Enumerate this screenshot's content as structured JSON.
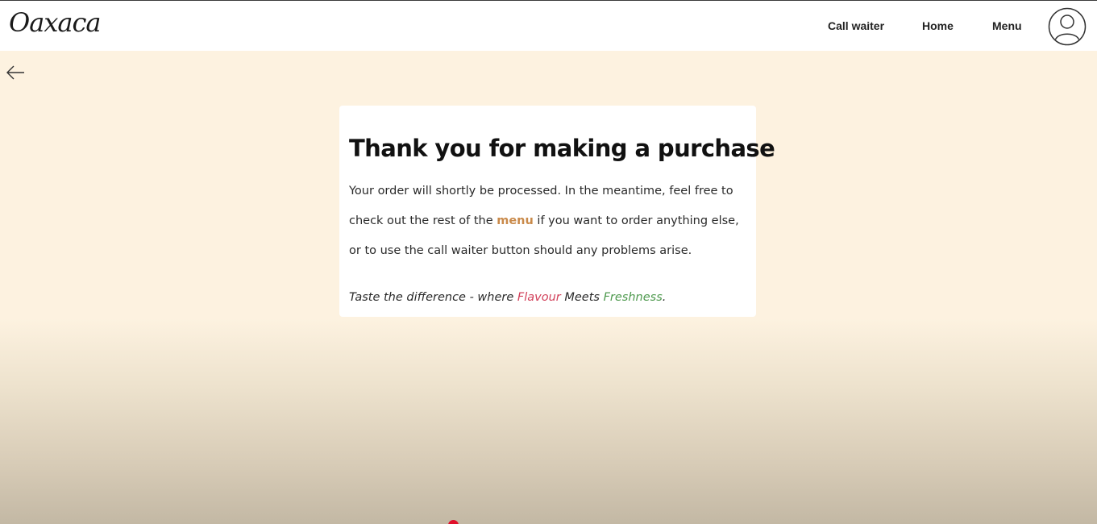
{
  "app": {
    "logo_text": "Oaxaca"
  },
  "nav": {
    "items": [
      {
        "label": "Call waiter"
      },
      {
        "label": "Home"
      },
      {
        "label": "Menu"
      }
    ],
    "avatar_icon": "user-avatar-icon"
  },
  "back": {
    "icon": "arrow-left-icon"
  },
  "confirmation": {
    "title": "Thank you for making a purchase",
    "line1": "Your order will shortly be processed. In the meantime, feel free to",
    "line2_before": "check out the rest of the ",
    "line2_link": "menu",
    "line2_after": " if you want to order anything else,",
    "line3": "or to use the call waiter button should any problems arise.",
    "tagline_before": "Taste the difference - where ",
    "tagline_flavour": "Flavour",
    "tagline_middle": " Meets ",
    "tagline_freshness": "Freshness",
    "tagline_end": "."
  },
  "colors": {
    "background": "#fdf2e0",
    "menu_link": "#c98a4a",
    "flavour": "#d2405a",
    "freshness": "#4f9a4f"
  }
}
